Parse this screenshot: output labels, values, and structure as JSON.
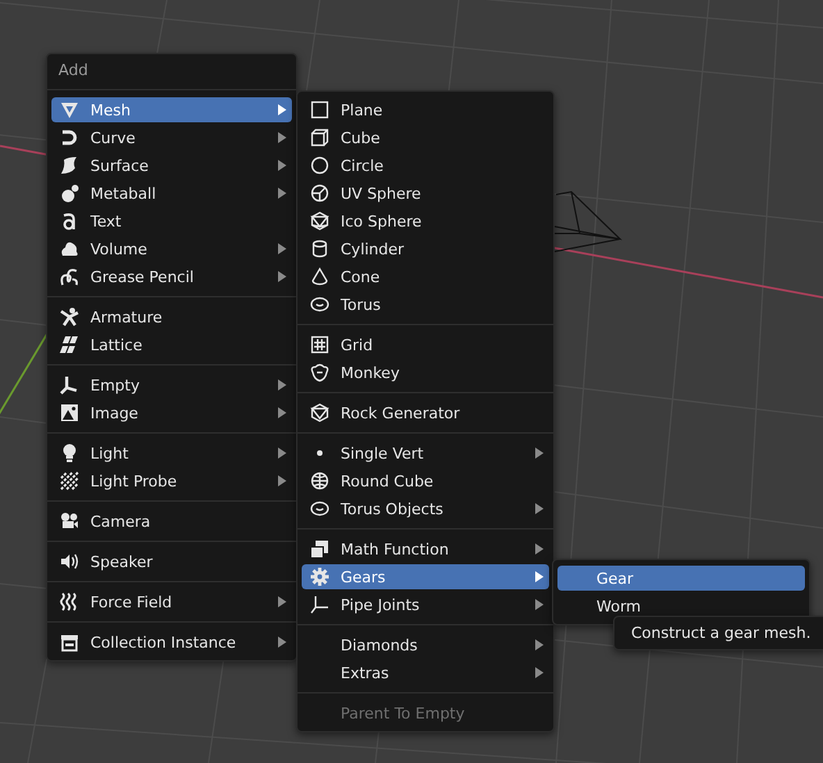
{
  "add_menu": {
    "title": "Add",
    "sections": [
      {
        "items": [
          {
            "label": "Mesh",
            "has_submenu": true,
            "selected": true
          },
          {
            "label": "Curve",
            "has_submenu": true,
            "selected": false
          },
          {
            "label": "Surface",
            "has_submenu": true,
            "selected": false
          },
          {
            "label": "Metaball",
            "has_submenu": true,
            "selected": false
          },
          {
            "label": "Text",
            "has_submenu": false,
            "selected": false
          },
          {
            "label": "Volume",
            "has_submenu": true,
            "selected": false
          },
          {
            "label": "Grease Pencil",
            "has_submenu": true,
            "selected": false
          }
        ]
      },
      {
        "items": [
          {
            "label": "Armature",
            "has_submenu": false,
            "selected": false
          },
          {
            "label": "Lattice",
            "has_submenu": false,
            "selected": false
          }
        ]
      },
      {
        "items": [
          {
            "label": "Empty",
            "has_submenu": true,
            "selected": false
          },
          {
            "label": "Image",
            "has_submenu": true,
            "selected": false
          }
        ]
      },
      {
        "items": [
          {
            "label": "Light",
            "has_submenu": true,
            "selected": false
          },
          {
            "label": "Light Probe",
            "has_submenu": true,
            "selected": false
          }
        ]
      },
      {
        "items": [
          {
            "label": "Camera",
            "has_submenu": false,
            "selected": false
          }
        ]
      },
      {
        "items": [
          {
            "label": "Speaker",
            "has_submenu": false,
            "selected": false
          }
        ]
      },
      {
        "items": [
          {
            "label": "Force Field",
            "has_submenu": true,
            "selected": false
          }
        ]
      },
      {
        "items": [
          {
            "label": "Collection Instance",
            "has_submenu": true,
            "selected": false
          }
        ]
      }
    ]
  },
  "mesh_menu": {
    "sections": [
      {
        "items": [
          {
            "label": "Plane",
            "has_submenu": false,
            "selected": false,
            "disabled": false
          },
          {
            "label": "Cube",
            "has_submenu": false,
            "selected": false,
            "disabled": false
          },
          {
            "label": "Circle",
            "has_submenu": false,
            "selected": false,
            "disabled": false
          },
          {
            "label": "UV Sphere",
            "has_submenu": false,
            "selected": false,
            "disabled": false
          },
          {
            "label": "Ico Sphere",
            "has_submenu": false,
            "selected": false,
            "disabled": false
          },
          {
            "label": "Cylinder",
            "has_submenu": false,
            "selected": false,
            "disabled": false
          },
          {
            "label": "Cone",
            "has_submenu": false,
            "selected": false,
            "disabled": false
          },
          {
            "label": "Torus",
            "has_submenu": false,
            "selected": false,
            "disabled": false
          }
        ]
      },
      {
        "items": [
          {
            "label": "Grid",
            "has_submenu": false,
            "selected": false,
            "disabled": false
          },
          {
            "label": "Monkey",
            "has_submenu": false,
            "selected": false,
            "disabled": false
          }
        ]
      },
      {
        "items": [
          {
            "label": "Rock Generator",
            "has_submenu": false,
            "selected": false,
            "disabled": false
          }
        ]
      },
      {
        "items": [
          {
            "label": "Single Vert",
            "has_submenu": true,
            "selected": false,
            "disabled": false
          },
          {
            "label": "Round Cube",
            "has_submenu": false,
            "selected": false,
            "disabled": false
          },
          {
            "label": "Torus Objects",
            "has_submenu": true,
            "selected": false,
            "disabled": false
          }
        ]
      },
      {
        "items": [
          {
            "label": "Math Function",
            "has_submenu": true,
            "selected": false,
            "disabled": false
          },
          {
            "label": "Gears",
            "has_submenu": true,
            "selected": true,
            "disabled": false
          },
          {
            "label": "Pipe Joints",
            "has_submenu": true,
            "selected": false,
            "disabled": false
          }
        ]
      },
      {
        "items": [
          {
            "label": "Diamonds",
            "has_submenu": true,
            "selected": false,
            "disabled": false
          },
          {
            "label": "Extras",
            "has_submenu": true,
            "selected": false,
            "disabled": false
          }
        ]
      },
      {
        "items": [
          {
            "label": "Parent To Empty",
            "has_submenu": false,
            "selected": false,
            "disabled": true
          }
        ]
      }
    ]
  },
  "gears_menu": {
    "sections": [
      {
        "items": [
          {
            "label": "Gear",
            "has_submenu": false,
            "selected": true
          },
          {
            "label": "Worm",
            "has_submenu": false,
            "selected": false
          }
        ]
      }
    ]
  },
  "tooltip": {
    "text": "Construct a gear mesh."
  }
}
